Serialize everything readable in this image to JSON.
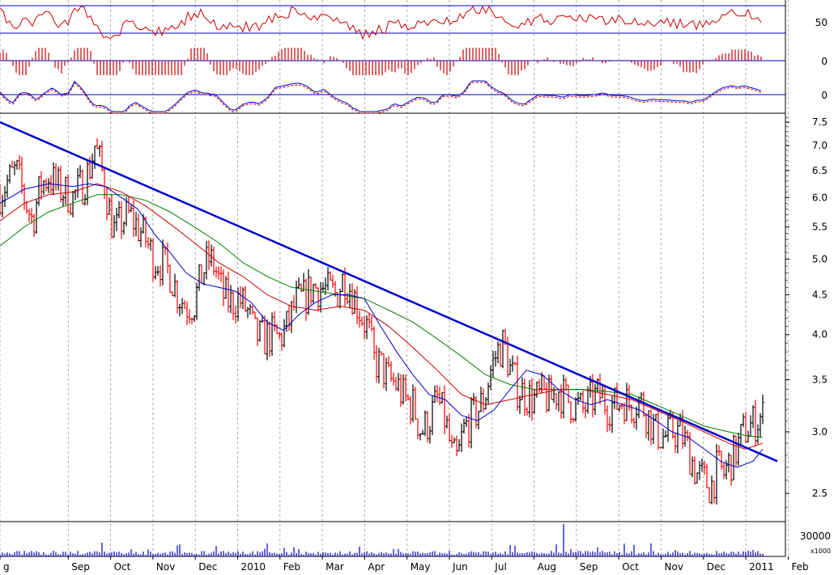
{
  "chart_data": {
    "type": "line",
    "scale": "log",
    "grid": true,
    "colors": {
      "up_bar": "#000000",
      "down_bar": "#ff0000",
      "ma_short": "#0000cc",
      "ma_mid": "#cc0000",
      "ma_long": "#008000",
      "trendline": "#0000cc",
      "rsi": "#cc0000",
      "histogram": "#cc0000",
      "macd": "#0000cc",
      "signal": "#cc0000",
      "volume": "#0000cc"
    },
    "x_months": [
      "g",
      "Sep",
      "Oct",
      "Nov",
      "Dec",
      "2010",
      "Feb",
      "Mar",
      "Apr",
      "May",
      "Jun",
      "Jul",
      "Aug",
      "Sep",
      "Oct",
      "Nov",
      "Dec",
      "2011",
      "Feb"
    ],
    "price_ticks": [
      "7.5",
      "7.0",
      "6.5",
      "6.0",
      "5.5",
      "5.0",
      "4.5",
      "4.0",
      "3.5",
      "3.0",
      "2.5"
    ],
    "ylim": [
      2.3,
      7.7
    ],
    "close_series": [
      [
        0,
        6.1
      ],
      [
        10,
        6.3
      ],
      [
        20,
        6.5
      ],
      [
        30,
        6.0
      ],
      [
        40,
        5.6
      ],
      [
        50,
        6.2
      ],
      [
        60,
        6.4
      ],
      [
        70,
        6.2
      ],
      [
        80,
        6.1
      ],
      [
        90,
        6.0
      ],
      [
        100,
        6.2
      ],
      [
        110,
        6.5
      ],
      [
        117,
        7.0
      ],
      [
        124,
        6.6
      ],
      [
        130,
        6.2
      ],
      [
        136,
        5.7
      ],
      [
        142,
        5.4
      ],
      [
        150,
        5.6
      ],
      [
        160,
        5.7
      ],
      [
        170,
        5.5
      ],
      [
        180,
        5.3
      ],
      [
        190,
        5.0
      ],
      [
        200,
        4.95
      ],
      [
        210,
        4.8
      ],
      [
        220,
        4.5
      ],
      [
        230,
        4.35
      ],
      [
        240,
        4.4
      ],
      [
        250,
        4.8
      ],
      [
        258,
        5.0
      ],
      [
        265,
        4.9
      ],
      [
        275,
        4.5
      ],
      [
        285,
        4.4
      ],
      [
        295,
        4.45
      ],
      [
        305,
        4.3
      ],
      [
        315,
        4.0
      ],
      [
        325,
        3.95
      ],
      [
        335,
        4.0
      ],
      [
        345,
        3.95
      ],
      [
        355,
        4.1
      ],
      [
        365,
        4.4
      ],
      [
        375,
        4.45
      ],
      [
        385,
        4.6
      ],
      [
        395,
        4.6
      ],
      [
        405,
        4.55
      ],
      [
        415,
        4.5
      ],
      [
        425,
        4.75
      ],
      [
        432,
        4.6
      ],
      [
        440,
        4.4
      ],
      [
        448,
        4.2
      ],
      [
        455,
        4.05
      ],
      [
        462,
        3.7
      ],
      [
        470,
        3.65
      ],
      [
        480,
        3.5
      ],
      [
        490,
        3.45
      ],
      [
        500,
        3.3
      ],
      [
        510,
        3.25
      ],
      [
        520,
        3.0
      ],
      [
        530,
        3.1
      ],
      [
        540,
        3.3
      ],
      [
        550,
        3.1
      ],
      [
        558,
        2.8
      ],
      [
        565,
        2.75
      ],
      [
        572,
        3.0
      ],
      [
        580,
        3.1
      ],
      [
        590,
        3.2
      ],
      [
        598,
        3.3
      ],
      [
        606,
        3.6
      ],
      [
        614,
        3.8
      ],
      [
        622,
        3.9
      ],
      [
        630,
        3.6
      ],
      [
        640,
        3.4
      ],
      [
        650,
        3.35
      ],
      [
        660,
        3.3
      ],
      [
        670,
        3.35
      ],
      [
        680,
        3.3
      ],
      [
        690,
        3.4
      ],
      [
        700,
        3.3
      ],
      [
        710,
        3.25
      ],
      [
        720,
        3.2
      ],
      [
        730,
        3.3
      ],
      [
        740,
        3.35
      ],
      [
        750,
        3.25
      ],
      [
        760,
        3.25
      ],
      [
        770,
        3.3
      ],
      [
        780,
        3.25
      ],
      [
        790,
        3.3
      ],
      [
        800,
        3.15
      ],
      [
        810,
        3.0
      ],
      [
        820,
        2.95
      ],
      [
        830,
        3.0
      ],
      [
        840,
        3.0
      ],
      [
        850,
        2.85
      ],
      [
        860,
        2.65
      ],
      [
        870,
        2.6
      ],
      [
        878,
        2.55
      ],
      [
        886,
        2.7
      ],
      [
        894,
        2.65
      ],
      [
        902,
        2.75
      ],
      [
        910,
        2.85
      ],
      [
        918,
        3.0
      ],
      [
        926,
        3.05
      ],
      [
        934,
        3.1
      ],
      [
        942,
        3.15
      ]
    ],
    "ma_short_series": [
      [
        0,
        5.9
      ],
      [
        30,
        6.15
      ],
      [
        60,
        6.25
      ],
      [
        90,
        6.2
      ],
      [
        110,
        6.25
      ],
      [
        130,
        6.2
      ],
      [
        150,
        6.0
      ],
      [
        170,
        5.8
      ],
      [
        190,
        5.4
      ],
      [
        210,
        5.1
      ],
      [
        230,
        4.8
      ],
      [
        250,
        4.65
      ],
      [
        270,
        4.6
      ],
      [
        290,
        4.55
      ],
      [
        310,
        4.4
      ],
      [
        330,
        4.15
      ],
      [
        350,
        4.05
      ],
      [
        370,
        4.25
      ],
      [
        390,
        4.4
      ],
      [
        410,
        4.5
      ],
      [
        430,
        4.5
      ],
      [
        450,
        4.45
      ],
      [
        470,
        4.1
      ],
      [
        490,
        3.8
      ],
      [
        510,
        3.55
      ],
      [
        530,
        3.35
      ],
      [
        550,
        3.3
      ],
      [
        570,
        3.15
      ],
      [
        590,
        3.1
      ],
      [
        610,
        3.2
      ],
      [
        630,
        3.4
      ],
      [
        650,
        3.6
      ],
      [
        670,
        3.55
      ],
      [
        690,
        3.4
      ],
      [
        710,
        3.3
      ],
      [
        730,
        3.25
      ],
      [
        750,
        3.3
      ],
      [
        770,
        3.25
      ],
      [
        790,
        3.2
      ],
      [
        810,
        3.1
      ],
      [
        830,
        3.0
      ],
      [
        850,
        2.95
      ],
      [
        870,
        2.85
      ],
      [
        890,
        2.75
      ],
      [
        910,
        2.7
      ],
      [
        930,
        2.75
      ],
      [
        942,
        2.85
      ]
    ],
    "ma_mid_series": [
      [
        0,
        5.6
      ],
      [
        30,
        5.9
      ],
      [
        60,
        6.05
      ],
      [
        90,
        6.1
      ],
      [
        120,
        6.25
      ],
      [
        150,
        6.1
      ],
      [
        180,
        5.85
      ],
      [
        210,
        5.55
      ],
      [
        240,
        5.25
      ],
      [
        270,
        4.95
      ],
      [
        300,
        4.75
      ],
      [
        330,
        4.5
      ],
      [
        360,
        4.35
      ],
      [
        390,
        4.3
      ],
      [
        420,
        4.35
      ],
      [
        450,
        4.3
      ],
      [
        480,
        4.1
      ],
      [
        510,
        3.85
      ],
      [
        540,
        3.6
      ],
      [
        570,
        3.35
      ],
      [
        600,
        3.25
      ],
      [
        630,
        3.3
      ],
      [
        660,
        3.35
      ],
      [
        690,
        3.4
      ],
      [
        720,
        3.4
      ],
      [
        750,
        3.35
      ],
      [
        780,
        3.3
      ],
      [
        810,
        3.2
      ],
      [
        840,
        3.1
      ],
      [
        870,
        3.0
      ],
      [
        900,
        2.9
      ],
      [
        920,
        2.85
      ],
      [
        942,
        2.9
      ]
    ],
    "ma_long_series": [
      [
        0,
        5.2
      ],
      [
        30,
        5.5
      ],
      [
        60,
        5.75
      ],
      [
        90,
        5.9
      ],
      [
        120,
        6.05
      ],
      [
        150,
        6.05
      ],
      [
        180,
        5.95
      ],
      [
        210,
        5.75
      ],
      [
        240,
        5.5
      ],
      [
        270,
        5.25
      ],
      [
        300,
        4.95
      ],
      [
        330,
        4.75
      ],
      [
        360,
        4.6
      ],
      [
        390,
        4.55
      ],
      [
        420,
        4.5
      ],
      [
        450,
        4.45
      ],
      [
        480,
        4.3
      ],
      [
        510,
        4.15
      ],
      [
        540,
        3.95
      ],
      [
        570,
        3.75
      ],
      [
        600,
        3.55
      ],
      [
        630,
        3.45
      ],
      [
        660,
        3.4
      ],
      [
        690,
        3.4
      ],
      [
        720,
        3.4
      ],
      [
        750,
        3.38
      ],
      [
        780,
        3.35
      ],
      [
        810,
        3.25
      ],
      [
        840,
        3.15
      ],
      [
        870,
        3.05
      ],
      [
        900,
        3.0
      ],
      [
        920,
        2.97
      ],
      [
        942,
        2.95
      ]
    ],
    "trendline": [
      [
        0,
        7.5
      ],
      [
        960,
        2.75
      ]
    ],
    "rsi": {
      "ticks": [
        "50"
      ],
      "level_upper": 70,
      "level_lower": 30
    },
    "histogram": {
      "ticks": [
        "0"
      ]
    },
    "macd": {
      "ticks": [
        "0"
      ]
    },
    "volume": {
      "ticks": [
        "30000",
        "x1000"
      ]
    }
  }
}
